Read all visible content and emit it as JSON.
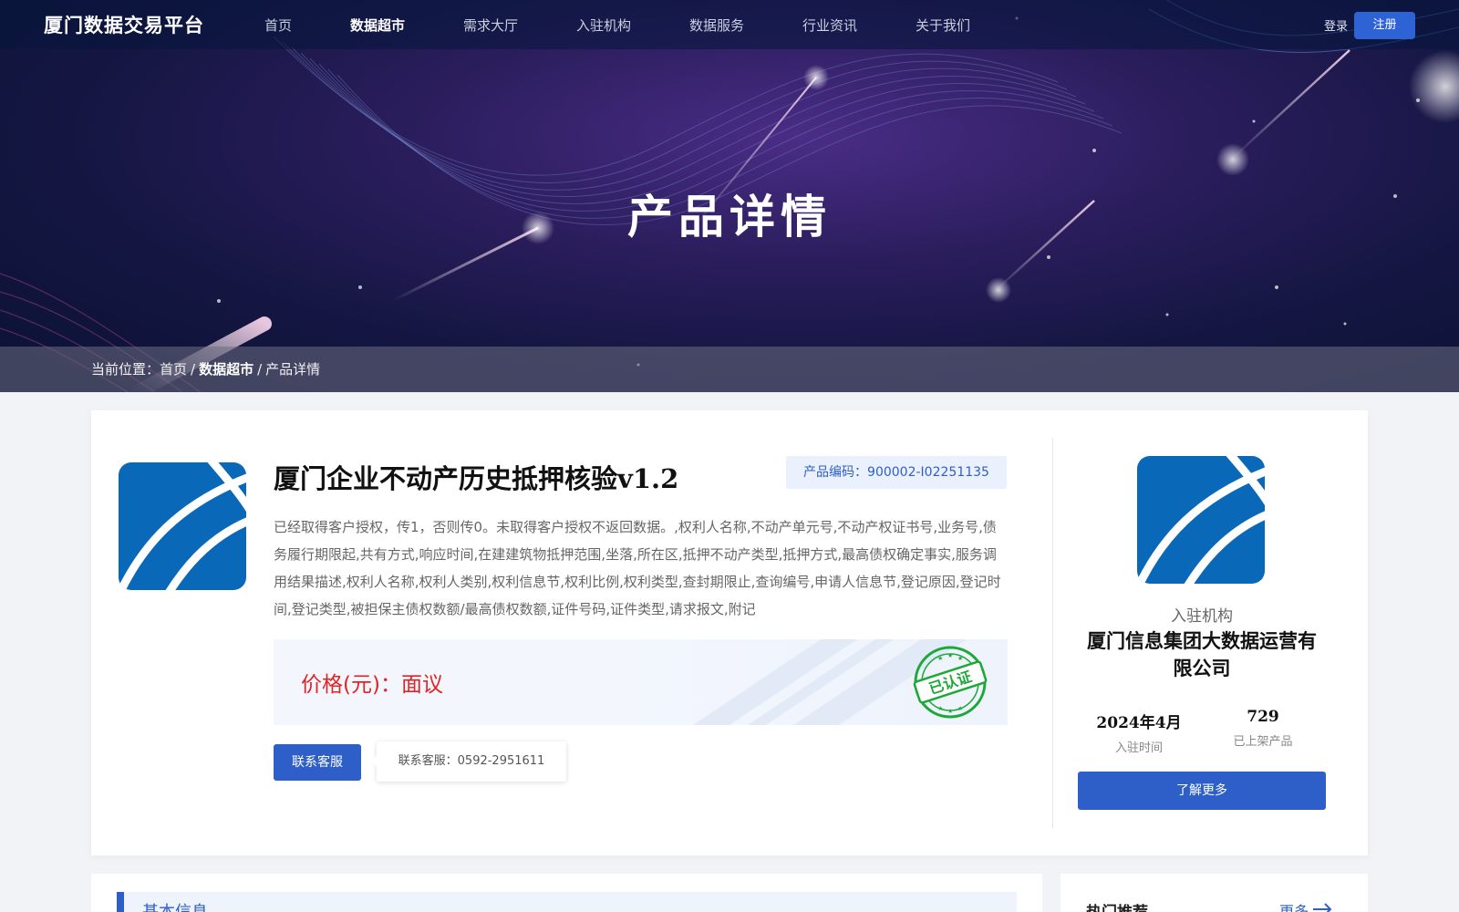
{
  "header": {
    "logo": "厦门数据交易平台",
    "nav": [
      {
        "label": "首页",
        "active": false
      },
      {
        "label": "数据超市",
        "active": true
      },
      {
        "label": "需求大厅",
        "active": false
      },
      {
        "label": "入驻机构",
        "active": false
      },
      {
        "label": "数据服务",
        "active": false
      },
      {
        "label": "行业资讯",
        "active": false
      },
      {
        "label": "关于我们",
        "active": false
      }
    ],
    "login": "登录",
    "register": "注册"
  },
  "hero": {
    "title": "产品详情"
  },
  "breadcrumb": {
    "prefix": "当前位置：",
    "home": "首页",
    "category": "数据超市",
    "current": "产品详情",
    "separator": "/"
  },
  "product": {
    "name": "厦门企业不动产历史抵押核验v1.2",
    "code": "产品编码：900002-I02251135",
    "description": "已经取得客户授权，传1，否则传0。未取得客户授权不返回数据。,权利人名称,不动产单元号,不动产权证书号,业务号,债务履行期限起,共有方式,响应时间,在建建筑物抵押范围,坐落,所在区,抵押不动产类型,抵押方式,最高债权确定事实,服务调用结果描述,权利人名称,权利人类别,权利信息节,权利比例,权利类型,查封期限止,查询编号,申请人信息节,登记原因,登记时间,登记类型,被担保主债权数额/最高债权数额,证件号码,证件类型,请求报文,附记",
    "price": "价格(元)：面议",
    "certified_badge": "已认证",
    "contact_button": "联系客服",
    "contact_tooltip": "联系客服：0592-2951611"
  },
  "organization": {
    "label": "入驻机构",
    "name": "厦门信息集团大数据运营有限公司",
    "join_date": "2024年4月",
    "join_date_label": "入驻时间",
    "product_count": "729",
    "product_count_label": "已上架产品",
    "more_button": "了解更多"
  },
  "sections": {
    "basic_info_title": "基本信息",
    "hot_title": "热门推荐",
    "hot_more": "更多"
  },
  "colors": {
    "primary": "#2e5fc8",
    "price": "#e02424",
    "badge_green": "#1fa83a",
    "logo_blue": "#0a68b9"
  },
  "icons": {
    "product_logo": "company-logo-icon",
    "badge": "certified-stamp-icon",
    "arrow": "arrow-right-icon"
  }
}
